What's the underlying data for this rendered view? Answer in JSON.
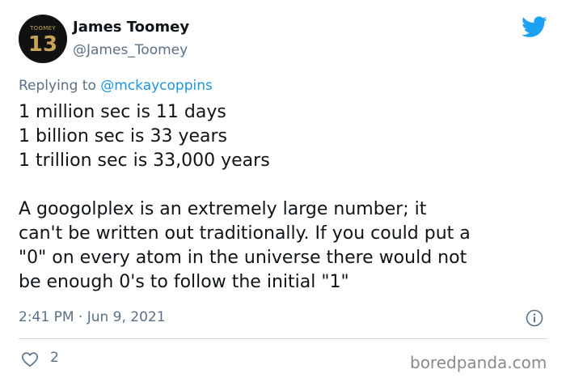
{
  "author": {
    "display_name": "James Toomey",
    "handle": "@James_Toomey",
    "avatar": {
      "team_text": "TOOMEY",
      "number": "13",
      "colors": {
        "background": "#111111",
        "foreground": "#c9a35a"
      }
    }
  },
  "reply": {
    "prefix": "Replying to",
    "mention": "@mckaycoppins"
  },
  "tweet": {
    "lines": [
      "1 million sec is 11 days",
      "1 billion sec is 33 years",
      "1 trillion sec is 33,000 years"
    ],
    "paragraph_lines": [
      "A googolplex is an extremely large number; it",
      "can't be written out traditionally. If you could put a",
      "\"0\" on every atom in the universe there would not",
      "be enough 0's to follow the initial \"1\""
    ]
  },
  "meta": {
    "timestamp": "2:41 PM · Jun 9, 2021"
  },
  "actions": {
    "like_count": "2"
  },
  "watermark": "boredpanda.com",
  "icons": {
    "brand": "twitter-bird-icon",
    "info": "info-icon",
    "like": "heart-icon"
  },
  "colors": {
    "text": "#0f1419",
    "secondary": "#5b7083",
    "link": "#1b95e0",
    "twitter_blue": "#1da1f2",
    "divider": "#cfd9de"
  }
}
